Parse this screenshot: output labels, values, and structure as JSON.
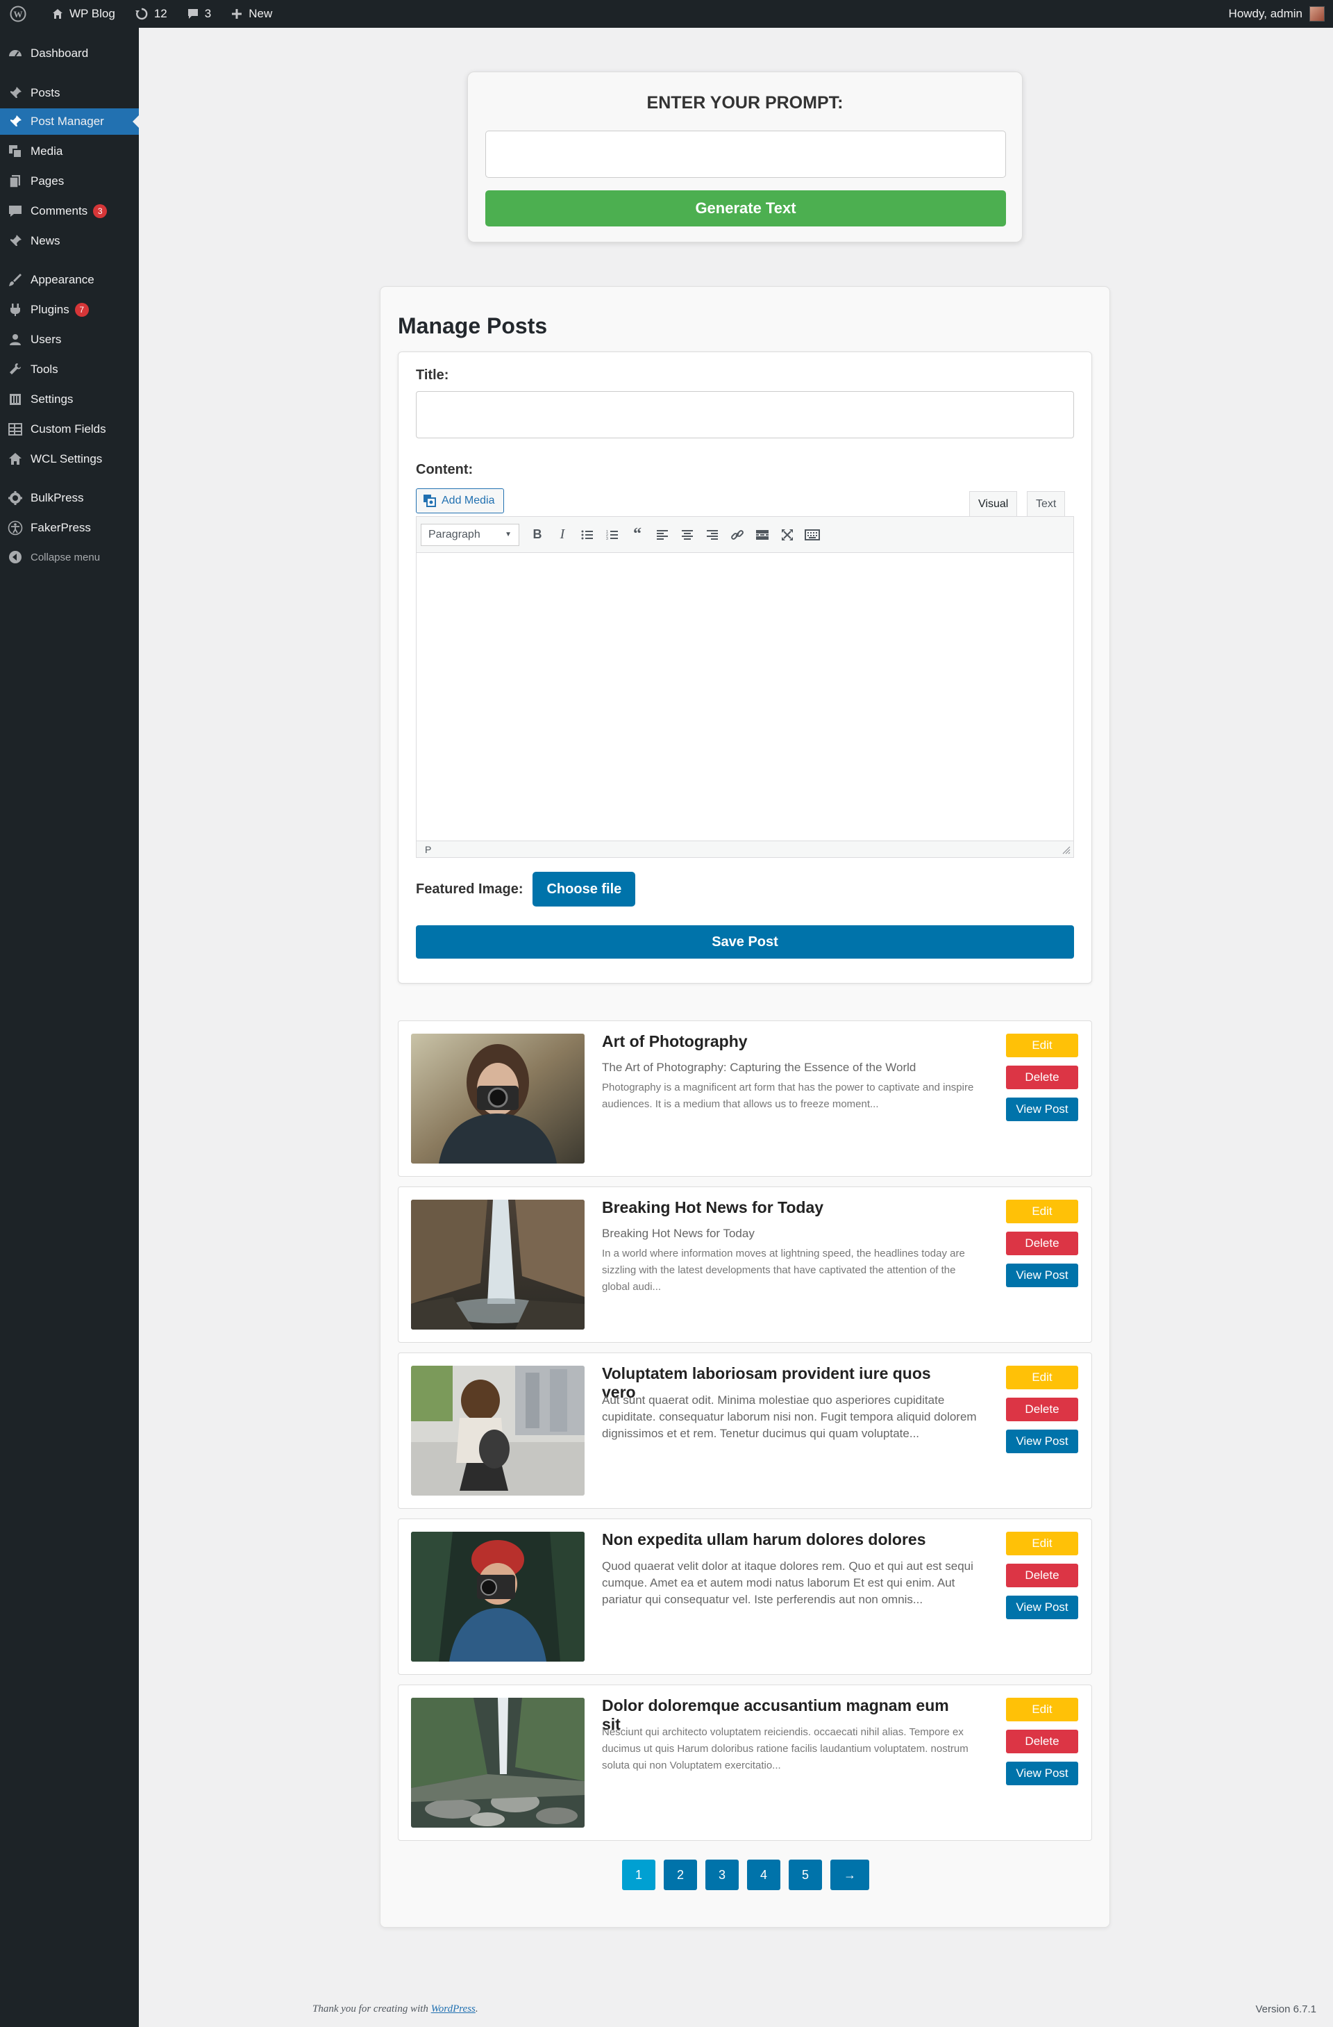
{
  "adminbar": {
    "site_name": "WP Blog",
    "updates_count": "12",
    "comments_count": "3",
    "new_label": "New",
    "howdy": "Howdy, admin"
  },
  "sidebar": {
    "items": [
      {
        "label": "Dashboard",
        "icon": "dashboard-icon"
      },
      {
        "label": "Posts",
        "icon": "pin-icon"
      },
      {
        "label": "Post Manager",
        "icon": "pin-icon"
      },
      {
        "label": "Media",
        "icon": "media-icon"
      },
      {
        "label": "Pages",
        "icon": "pages-icon"
      },
      {
        "label": "Comments",
        "icon": "comments-icon",
        "badge": "3"
      },
      {
        "label": "News",
        "icon": "pin-icon"
      },
      {
        "label": "Appearance",
        "icon": "brush-icon"
      },
      {
        "label": "Plugins",
        "icon": "plugins-icon",
        "badge": "7"
      },
      {
        "label": "Users",
        "icon": "users-icon"
      },
      {
        "label": "Tools",
        "icon": "tools-icon"
      },
      {
        "label": "Settings",
        "icon": "settings-icon"
      },
      {
        "label": "Custom Fields",
        "icon": "custom-fields-icon"
      },
      {
        "label": "WCL Settings",
        "icon": "home-icon"
      },
      {
        "label": "BulkPress",
        "icon": "gear-icon"
      },
      {
        "label": "FakerPress",
        "icon": "accessibility-icon"
      },
      {
        "label": "Collapse menu",
        "icon": "collapse-icon"
      }
    ]
  },
  "prompt": {
    "heading": "ENTER YOUR PROMPT:",
    "value": "",
    "button": "Generate Text"
  },
  "manage": {
    "heading": "Manage Posts",
    "title_label": "Title:",
    "content_label": "Content:",
    "add_media": "Add Media",
    "tab_visual": "Visual",
    "tab_text": "Text",
    "format": "Paragraph",
    "status_path": "P",
    "featured_label": "Featured Image:",
    "choose_file": "Choose file",
    "save_post": "Save Post"
  },
  "posts": [
    {
      "title": "Art of Photography",
      "subtitle": "The Art of Photography: Capturing the Essence of the World",
      "excerpt": "Photography is a magnificent art form that has the power to captivate and inspire audiences. It is a medium that allows us to freeze moment...",
      "edit": "Edit",
      "delete": "Delete",
      "view": "View Post"
    },
    {
      "title": "Breaking Hot News for Today",
      "subtitle": "Breaking Hot News for Today",
      "excerpt": "In a world where information moves at lightning speed, the headlines today are sizzling with the latest developments that have captivated the attention of the global audi...",
      "edit": "Edit",
      "delete": "Delete",
      "view": "View Post"
    },
    {
      "title": "Voluptatem laboriosam provident iure quos vero",
      "subtitle": "",
      "excerpt": "Aut sunt quaerat odit. Minima molestiae quo asperiores cupiditate cupiditate. consequatur laborum nisi non. Fugit tempora aliquid dolorem dignissimos et et rem. Tenetur ducimus qui quam voluptate...",
      "edit": "Edit",
      "delete": "Delete",
      "view": "View Post"
    },
    {
      "title": "Non expedita ullam harum dolores dolores",
      "subtitle": "",
      "excerpt": "Quod quaerat velit dolor at itaque dolores rem. Quo et qui aut est sequi cumque. Amet ea et autem modi natus laborum Et est qui enim. Aut pariatur qui consequatur vel. Iste perferendis aut non omnis...",
      "edit": "Edit",
      "delete": "Delete",
      "view": "View Post"
    },
    {
      "title": "Dolor doloremque accusantium magnam eum sit",
      "subtitle": "",
      "excerpt": "Nesciunt qui architecto voluptatem reiciendis. occaecati nihil alias. Tempore ex ducimus ut quis Harum doloribus ratione facilis laudantium voluptatem. nostrum soluta qui non Voluptatem exercitatio...",
      "edit": "Edit",
      "delete": "Delete",
      "view": "View Post"
    }
  ],
  "pagination": {
    "pages": [
      "1",
      "2",
      "3",
      "4",
      "5"
    ],
    "current": "1",
    "next": "→"
  },
  "footer": {
    "thanks_prefix": "Thank you for creating with ",
    "thanks_link": "WordPress",
    "thanks_suffix": ".",
    "version": "Version 6.7.1"
  },
  "colors": {
    "admin_dark": "#1d2327",
    "wp_blue": "#2271b1",
    "button_blue": "#0073aa",
    "green": "#4caf50",
    "edit_yellow": "#ffc107",
    "delete_red": "#dc3545",
    "badge_red": "#d63638"
  }
}
